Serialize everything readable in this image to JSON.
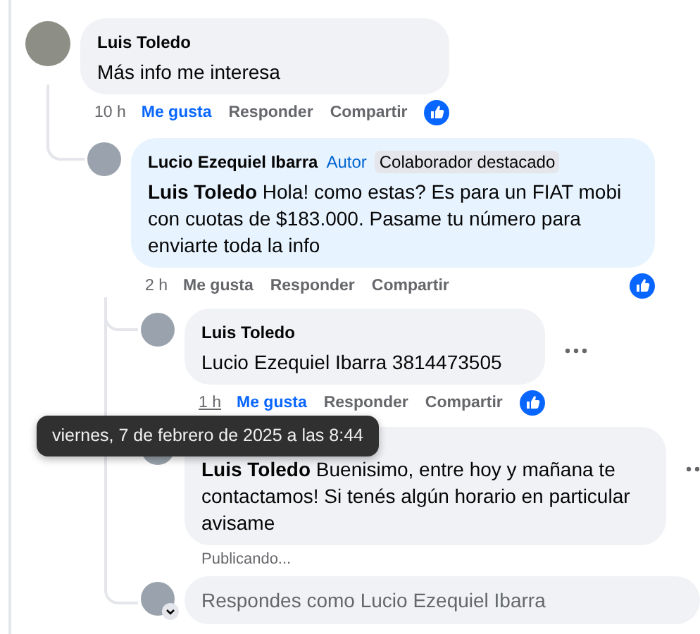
{
  "comments": [
    {
      "kind": "comment",
      "author": "Luis Toledo",
      "text": "Más info me interesa",
      "time": "10 h",
      "actions": [
        "Me gusta",
        "Responder",
        "Compartir"
      ],
      "liked": true,
      "reacted": true,
      "children": [
        {
          "kind": "comment",
          "author": "Lucio Ezequiel Ibarra",
          "badges": [
            {
              "label": "Autor",
              "kind": "author"
            },
            {
              "label": "Colaborador destacado",
              "kind": "fan"
            }
          ],
          "text": "**Luis Toledo** Hola! como estas? Es para un FIAT mobi con cuotas de $183.000. Pasame tu número para enviarte toda la info",
          "time": "2 h",
          "actions": [
            "Me gusta",
            "Responder",
            "Compartir"
          ],
          "liked": false,
          "reacted": true,
          "children": [
            {
              "kind": "comment",
              "author": "Luis Toledo",
              "text": "Lucio Ezequiel Ibarra 3814473505",
              "time": "1 h",
              "time_hovered": true,
              "actions": [
                "Me gusta",
                "Responder",
                "Compartir"
              ],
              "liked": true,
              "reacted": true,
              "menu": true
            },
            {
              "kind": "comment",
              "text": "**Luis Toledo** Buenisimo, entre hoy y mañana te contactamos! Si tenés algún horario en particular avisame",
              "status": "Publicando...",
              "menu": true,
              "tooltip": "viernes, 7 de febrero de 2025 a las 8:44"
            },
            {
              "kind": "composer",
              "placeholder": "Respondes como Lucio Ezequiel Ibarra"
            }
          ]
        }
      ]
    }
  ]
}
